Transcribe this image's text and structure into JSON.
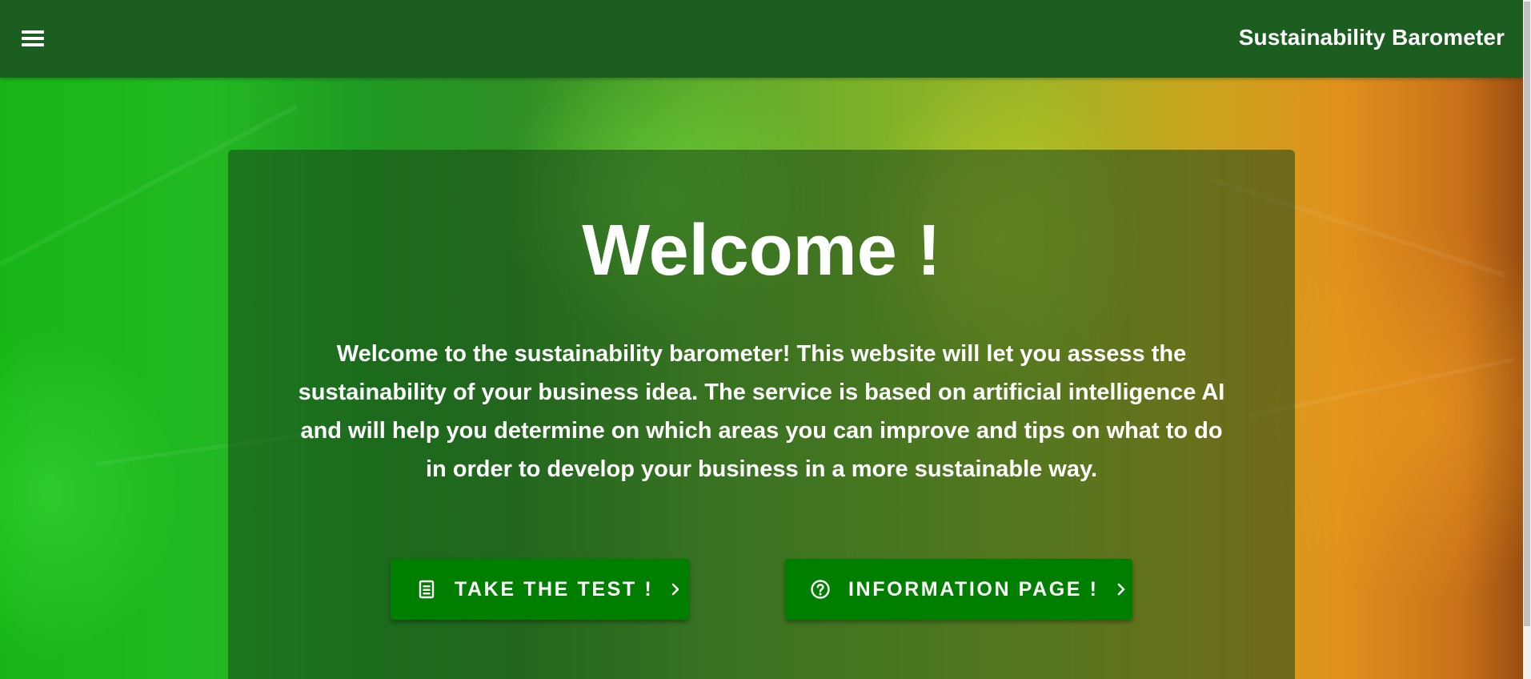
{
  "header": {
    "menu_icon": "hamburger-menu-icon",
    "app_title": "Sustainability Barometer"
  },
  "main": {
    "title": "Welcome !",
    "intro_lines": [
      "Welcome to the sustainability barometer! This website will let you assess the",
      "sustainability of your business idea. The service is based on artificial intelligence AI",
      "and will help you determine on which areas you can improve and tips on what to do",
      "in order to develop your business in a more sustainable way."
    ],
    "buttons": [
      {
        "label": "TAKE THE TEST !",
        "icon": "clipboard-list-icon",
        "trailing_icon": "chevron-right-icon"
      },
      {
        "label": "INFORMATION PAGE !",
        "icon": "help-circle-icon",
        "trailing_icon": "chevron-right-icon"
      }
    ]
  },
  "colors": {
    "header_bg": "#1b5e20",
    "button_bg": "#007e00",
    "card_overlay": "rgba(25,70,25,0.55)",
    "text": "#ffffff"
  }
}
